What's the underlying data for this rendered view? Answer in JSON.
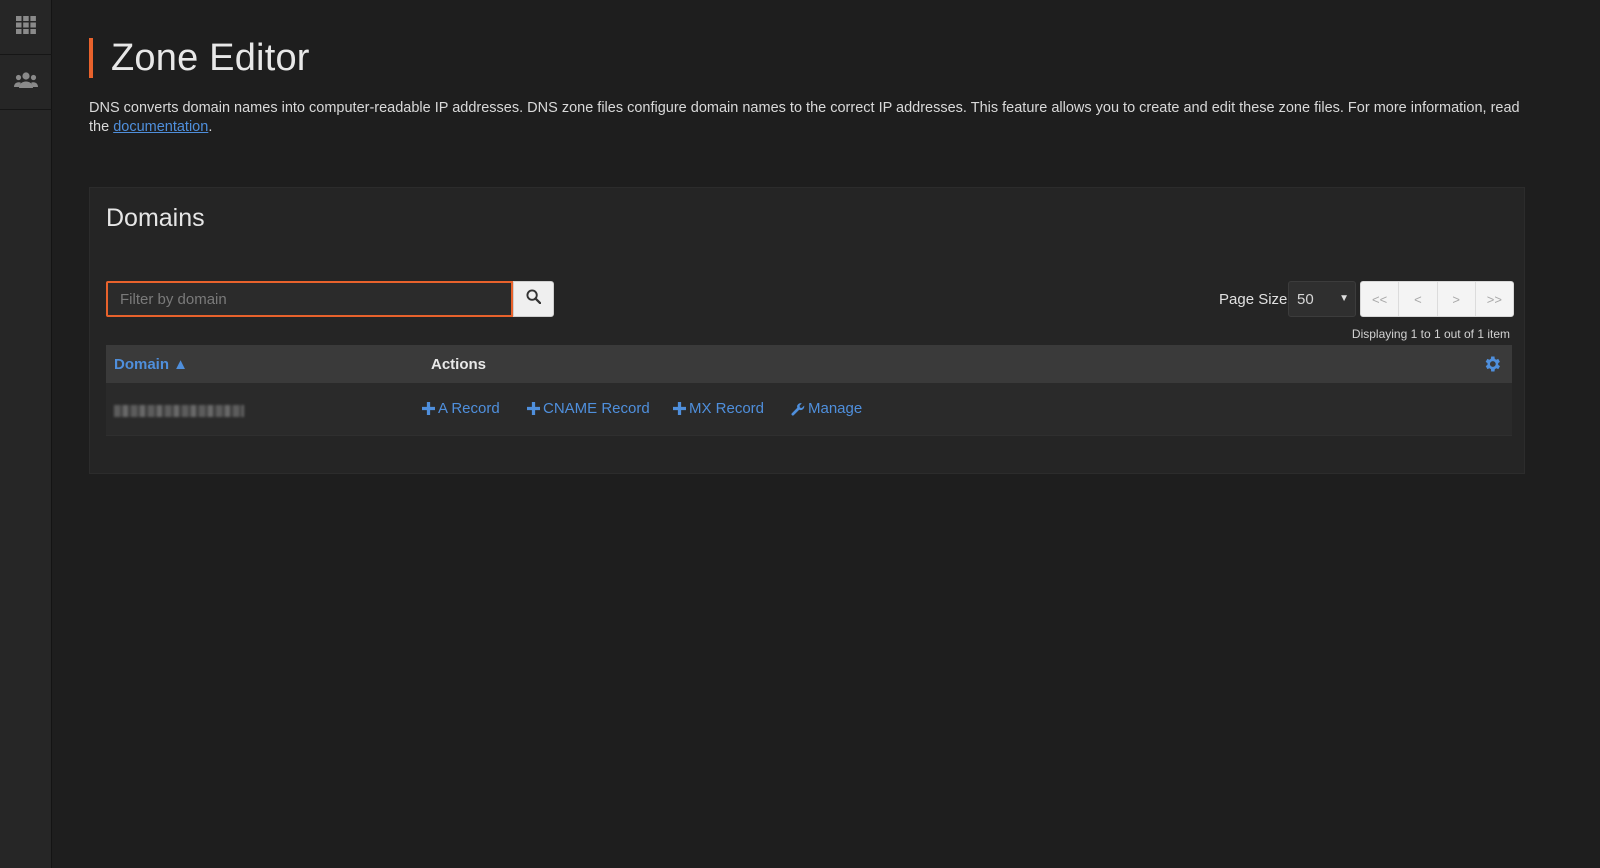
{
  "sidebar": {
    "items": [
      {
        "icon": "apps-grid-icon"
      },
      {
        "icon": "users-icon"
      }
    ]
  },
  "page": {
    "title": "Zone Editor",
    "description_text": "DNS converts domain names into computer-readable IP addresses. DNS zone files configure domain names to the correct IP addresses. This feature allows you to create and edit these zone files. For more information, read the ",
    "documentation_link": "documentation",
    "description_end": "."
  },
  "panel": {
    "title": "Domains",
    "search": {
      "placeholder": "Filter by domain",
      "value": ""
    },
    "page_size_label": "Page Size",
    "page_size_value": "50",
    "pager": {
      "first": "<<",
      "prev": "<",
      "next": ">",
      "last": ">>"
    },
    "displaying": "Displaying 1 to 1 out of 1 item"
  },
  "table": {
    "headers": {
      "domain": "Domain ▲",
      "actions": "Actions"
    },
    "rows": [
      {
        "domain": "",
        "actions": [
          {
            "label": "A Record",
            "icon": "plus-icon"
          },
          {
            "label": "CNAME Record",
            "icon": "plus-icon"
          },
          {
            "label": "MX Record",
            "icon": "plus-icon"
          },
          {
            "label": "Manage",
            "icon": "wrench-icon"
          }
        ]
      }
    ]
  },
  "colors": {
    "accent": "#e8622c",
    "link": "#4f8fdc",
    "background": "#1e1e1e"
  }
}
